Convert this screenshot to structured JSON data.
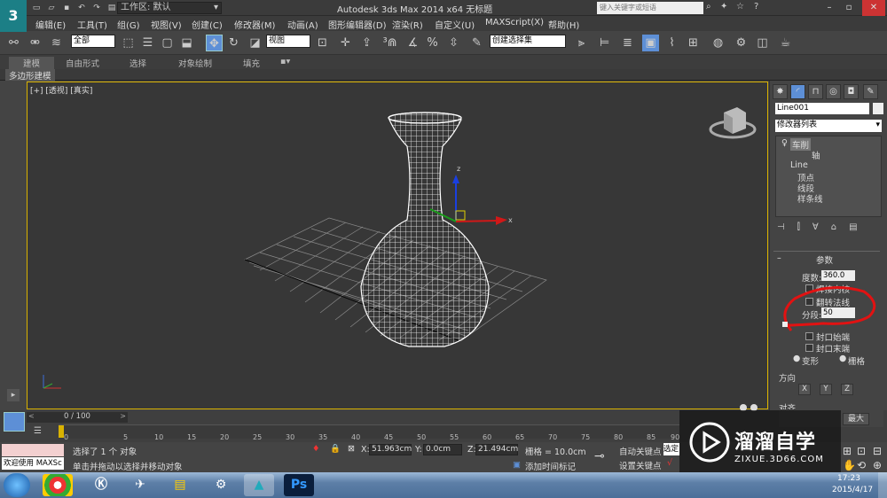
{
  "titlebar": {
    "workspace": "工作区: 默认",
    "window_title": "Autodesk 3ds Max  2014 x64     无标题",
    "search_placeholder": "键入关键字或短语"
  },
  "menu": [
    "编辑(E)",
    "工具(T)",
    "组(G)",
    "视图(V)",
    "创建(C)",
    "修改器(M)",
    "动画(A)",
    "图形编辑器(D)",
    "渲染(R)",
    "自定义(U)",
    "MAXScript(X)",
    "帮助(H)"
  ],
  "toolbar": {
    "selection_filter": "全部",
    "ref_coord": "视图",
    "named_selection": "创建选择集"
  },
  "ribbon": {
    "tabs": [
      "建模",
      "自由形式",
      "选择",
      "对象绘制",
      "填充"
    ],
    "subtab": "多边形建模"
  },
  "viewport": {
    "label": "[+] [透视] [真实]"
  },
  "command_panel": {
    "object_name": "Line001",
    "modifier_list": "修改器列表",
    "stack": [
      "车削",
      "轴",
      "Line",
      "顶点",
      "线段",
      "样条线"
    ],
    "params_title": "参数",
    "degrees_label": "度数:",
    "degrees_value": "360.0",
    "weld_core": "焊接内核",
    "flip_normals": "翻转法线",
    "segments_label": "分段:",
    "segments_value": "50",
    "cap_start": "封口始端",
    "cap_end": "封口末端",
    "morph": "变形",
    "grid": "栅格",
    "direction_title": "方向",
    "dir_buttons": [
      "X",
      "Y",
      "Z"
    ],
    "align_title": "对齐",
    "max_btn": "最大"
  },
  "timeline": {
    "frame_counter": "0 / 100",
    "ticks": [
      "0",
      "5",
      "10",
      "15",
      "20",
      "25",
      "30",
      "35",
      "40",
      "45",
      "50",
      "55",
      "60",
      "65",
      "70",
      "75",
      "80",
      "85",
      "90"
    ]
  },
  "status": {
    "maxscript_welcome": "欢迎使用 MAXSc",
    "selected": "选择了 1 个 对象",
    "prompt": "单击并拖动以选择并移动对象",
    "x_label": "X:",
    "x_value": "51.963cm",
    "y_label": "Y:",
    "y_value": "0.0cm",
    "z_label": "Z:",
    "z_value": "21.494cm",
    "grid": "栅格 = 10.0cm",
    "add_time_tag": "添加时间标记",
    "auto_key": "自动关键点",
    "set_key": "设置关键点",
    "selected_btn": "选定"
  },
  "watermark": {
    "brand": "溜溜自学",
    "url": "ZIXUE.3D66.COM"
  },
  "taskbar": {
    "time": "17:23",
    "date": "2015/4/17",
    "ps_label": "Ps"
  }
}
